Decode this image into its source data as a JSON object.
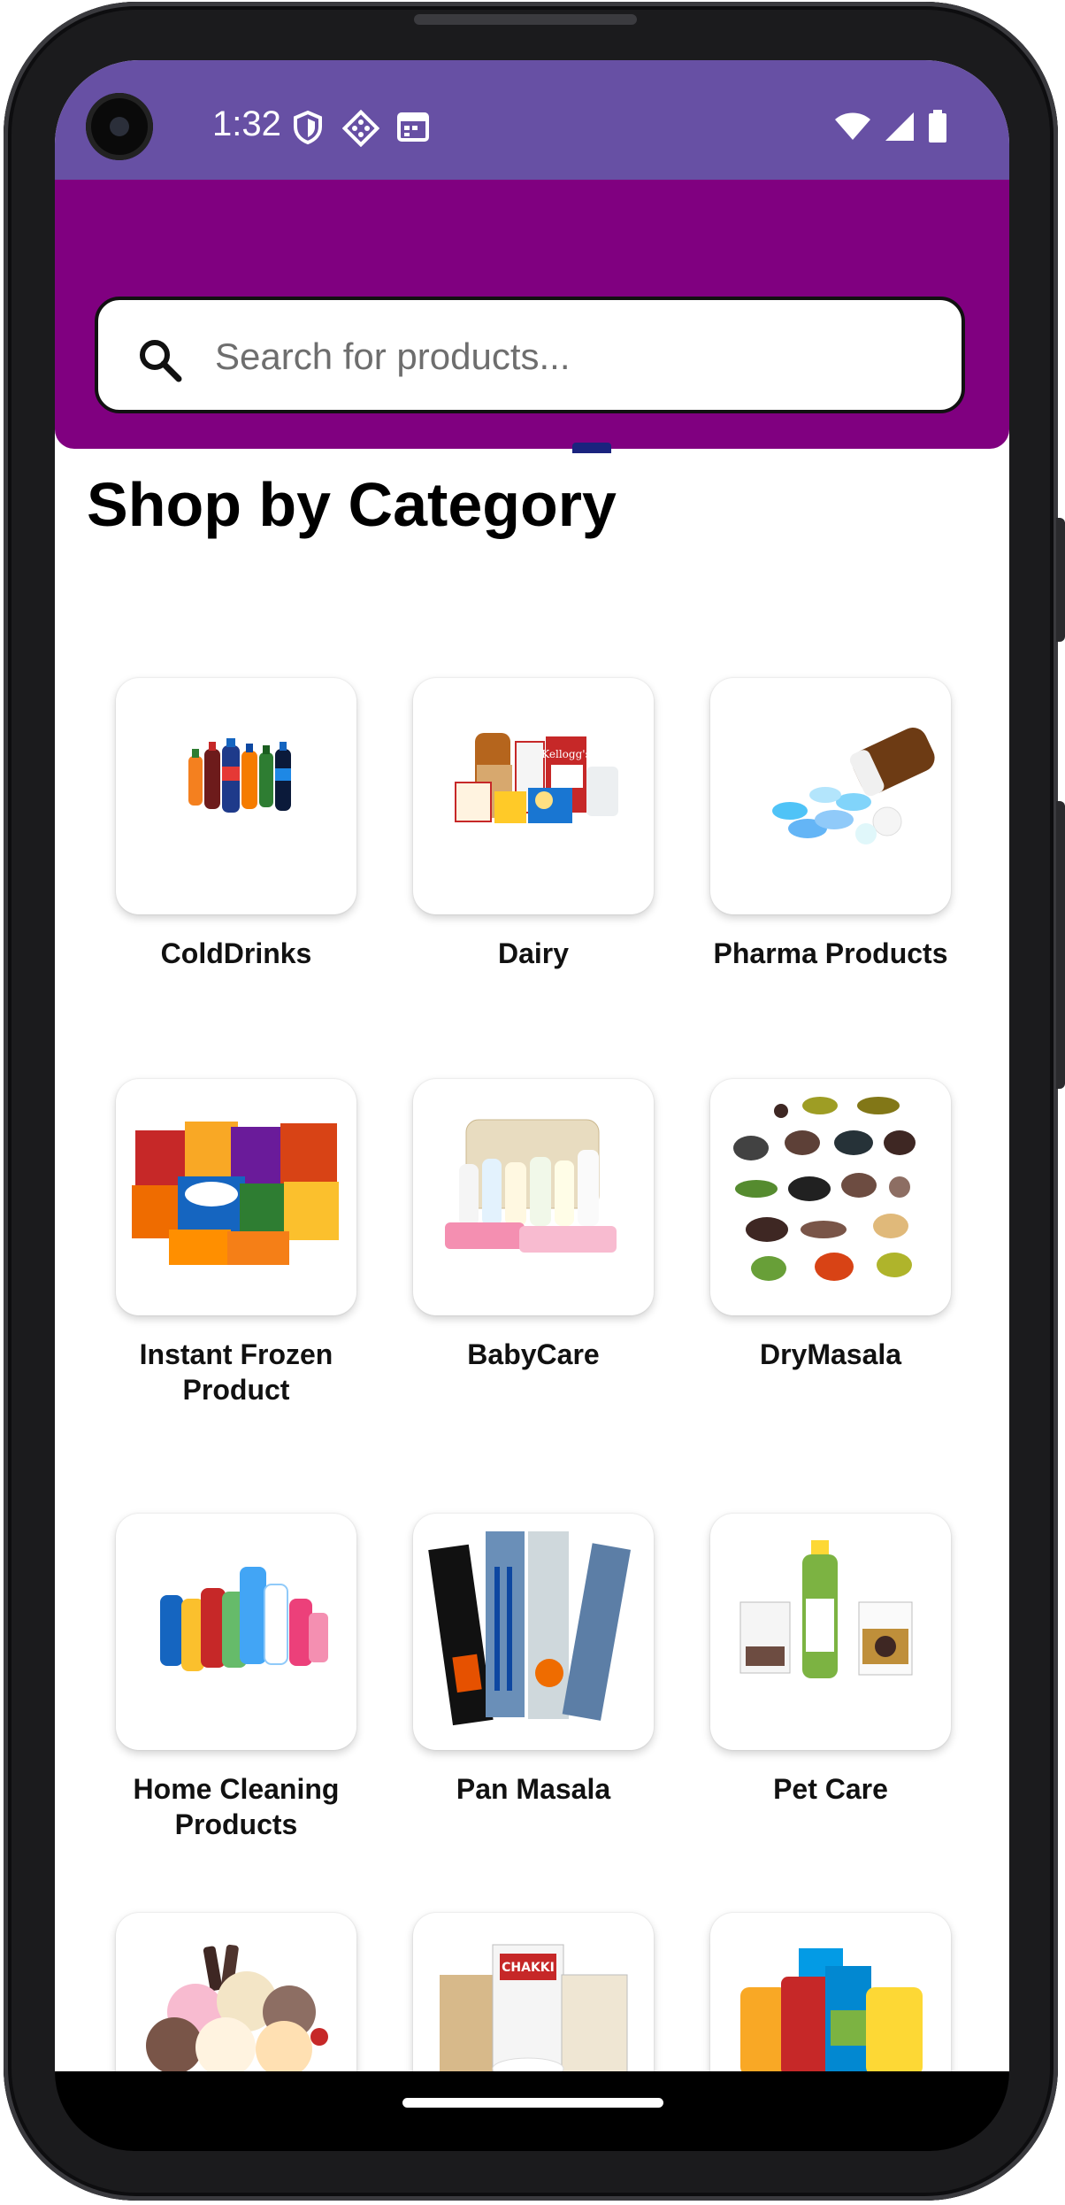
{
  "status_bar": {
    "time": "1:32",
    "left_icons": [
      "shield-icon",
      "diamond-grid-icon",
      "calendar-icon"
    ],
    "right_icons": [
      "wifi-icon",
      "cell-signal-icon",
      "battery-icon"
    ],
    "background": "#6750a4"
  },
  "header": {
    "background": "#800080",
    "search": {
      "placeholder": "Search for products...",
      "value": ""
    }
  },
  "main": {
    "section_title": "Shop by Category",
    "categories": [
      {
        "label": "ColdDrinks",
        "icon": "cold-drinks-image"
      },
      {
        "label": "Dairy",
        "icon": "dairy-image"
      },
      {
        "label": "Pharma Products",
        "icon": "pharma-image"
      },
      {
        "label": "Instant Frozen Product",
        "icon": "frozen-food-image"
      },
      {
        "label": "BabyCare",
        "icon": "baby-care-image"
      },
      {
        "label": "DryMasala",
        "icon": "dry-masala-image"
      },
      {
        "label": "Home Cleaning Products",
        "icon": "home-cleaning-image"
      },
      {
        "label": "Pan Masala",
        "icon": "pan-masala-image"
      },
      {
        "label": "Pet Care",
        "icon": "pet-care-image"
      },
      {
        "label": "",
        "icon": "ice-cream-image"
      },
      {
        "label": "",
        "icon": "atta-rice-image"
      },
      {
        "label": "",
        "icon": "ghee-oil-image"
      }
    ]
  }
}
